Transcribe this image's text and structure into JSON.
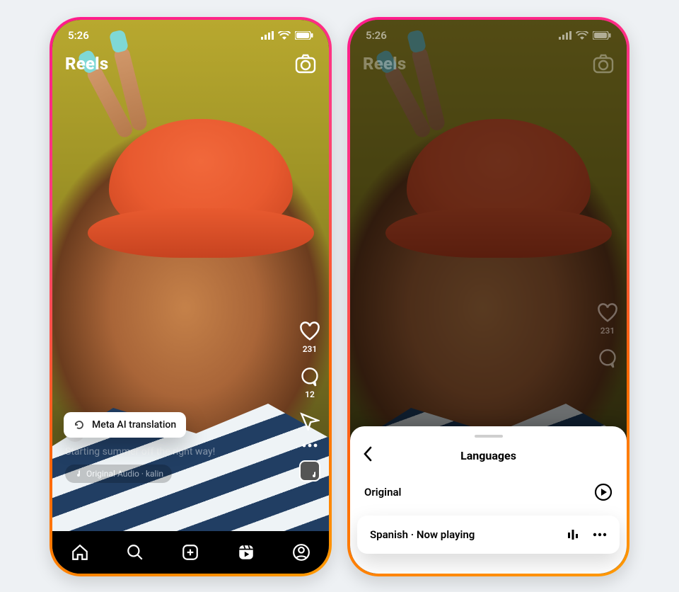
{
  "status": {
    "time": "5:26"
  },
  "header": {
    "title": "Reels"
  },
  "rail": {
    "likes": "231",
    "comments": "12"
  },
  "post": {
    "caption": "Starting summer off the right way!",
    "audio_label": "Original Audio · kalin"
  },
  "translation": {
    "label": "Meta AI translation"
  },
  "sheet": {
    "title": "Languages",
    "original_label": "Original",
    "spanish_label": "Spanish · Now playing"
  }
}
